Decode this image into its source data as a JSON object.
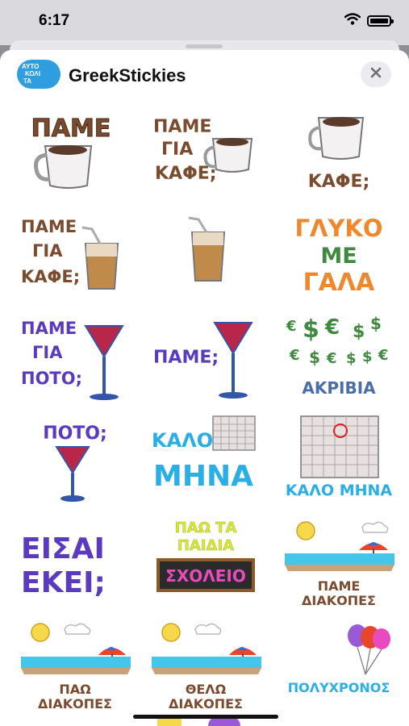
{
  "status": {
    "time": "6:17",
    "icons": [
      "wifi-icon",
      "battery-icon"
    ]
  },
  "app": {
    "title": "GreekStickies",
    "icon_lines": [
      "ΑΥΤΟ",
      "ΚΟΛΙ",
      "ΤΑ"
    ],
    "icon_color": "#2f9ee0",
    "close_icon": "close-icon"
  },
  "stickers": [
    {
      "lines": [
        "ΠΑΜΕ"
      ],
      "color": "#7a4b2e"
    },
    {
      "lines": [
        "ΠΑΜΕ",
        "ΓΙΑ",
        "ΚΑΦΕ;"
      ],
      "color": "#7a4b2e"
    },
    {
      "lines": [
        "ΚΑΦΕ;"
      ],
      "color": "#7a4b2e"
    },
    {
      "lines": [
        "ΠΑΜΕ",
        "ΓΙΑ",
        "ΚΑΦΕ;"
      ],
      "color": "#7a4b2e"
    },
    {
      "lines": [],
      "color": "#7a4b2e"
    },
    {
      "lines": [
        "ΓΛΥΚΟ",
        "ΜΕ",
        "ΓΑΛΑ"
      ],
      "color": "#f0872c"
    },
    {
      "lines": [
        "ΠΑΜΕ",
        "ΓΙΑ",
        "ΠΟΤΟ;"
      ],
      "color": "#5a3bbf"
    },
    {
      "lines": [
        "ΠΑΜΕ;"
      ],
      "color": "#5a3bbf"
    },
    {
      "lines": [
        "ΑΚΡΙΒΙΑ"
      ],
      "color": "#4a6ea8"
    },
    {
      "lines": [
        "ΠΟΤΟ;"
      ],
      "color": "#5a3bbf"
    },
    {
      "lines": [
        "ΚΑΛΟ",
        "ΜΗΝΑ"
      ],
      "color": "#2aaee6"
    },
    {
      "lines": [
        "ΚΑΛΟ ΜΗΝΑ"
      ],
      "color": "#2aaee6"
    },
    {
      "lines": [
        "ΕΙΣΑΙ",
        "ΕΚΕΙ;"
      ],
      "color": "#5a3bbf"
    },
    {
      "lines": [
        "ΠΑΩ ΤΑ",
        "ΠΑΙΔΙΑ",
        "ΣΧΟΛΕΙΟ"
      ],
      "color": "#d6e83a"
    },
    {
      "lines": [
        "ΠΑΜΕ",
        "ΔΙΑΚΟΠΕΣ"
      ],
      "color": "#7a4b2e"
    },
    {
      "lines": [
        "ΠΑΩ",
        "ΔΙΑΚΟΠΕΣ"
      ],
      "color": "#7a4b2e"
    },
    {
      "lines": [
        "ΘΕΛΩ",
        "ΔΙΑΚΟΠΕΣ"
      ],
      "color": "#7a4b2e"
    },
    {
      "lines": [
        "ΠΟΛΥΧΡΟΝΟΣ"
      ],
      "color": "#2aaee6"
    }
  ]
}
